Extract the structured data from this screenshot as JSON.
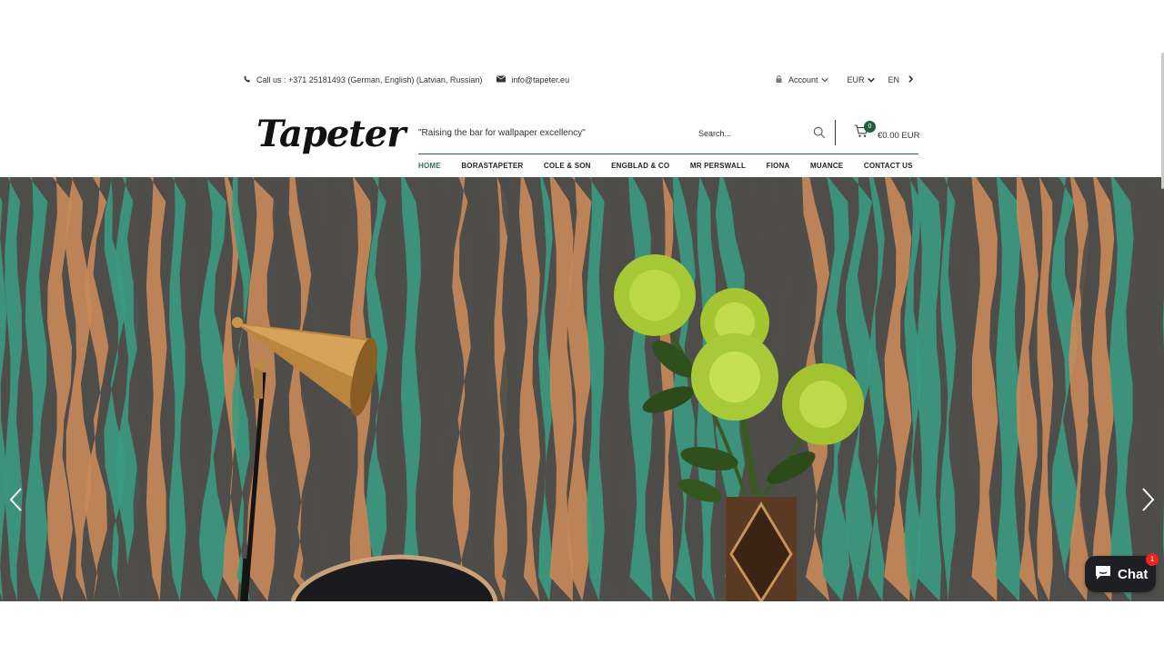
{
  "topbar": {
    "phone": "Call us : +371 25181493 (German, English) (Latvian, Russian)",
    "email": "info@tapeter.eu",
    "account": "Account",
    "currency": "EUR",
    "language": "EN"
  },
  "header": {
    "logo": "Tapeter",
    "tagline": "\"Raising the bar for wallpaper excellency\"",
    "search_placeholder": "Search...",
    "cart_count": "0",
    "cart_total": "€0.00 EUR"
  },
  "nav": {
    "items": [
      "HOME",
      "BORASTAPETER",
      "COLE & SON",
      "ENGBLAD & CO",
      "MR PERSWALL",
      "FIONA",
      "MUANCE",
      "CONTACT US"
    ]
  },
  "chat": {
    "label": "Chat",
    "badge": "1"
  },
  "colors": {
    "accent": "#2e6e58",
    "badge": "#1f5e3e",
    "wall_orange": "#c98a5a",
    "wall_teal": "#3a9a80",
    "wall_dark": "#4e4c49"
  },
  "icons": [
    "phone-icon",
    "envelope-icon",
    "lock-icon",
    "chevron-down-icon",
    "chevron-right-icon",
    "search-icon",
    "cart-icon",
    "chevron-left-icon",
    "chat-bubble-icon"
  ]
}
